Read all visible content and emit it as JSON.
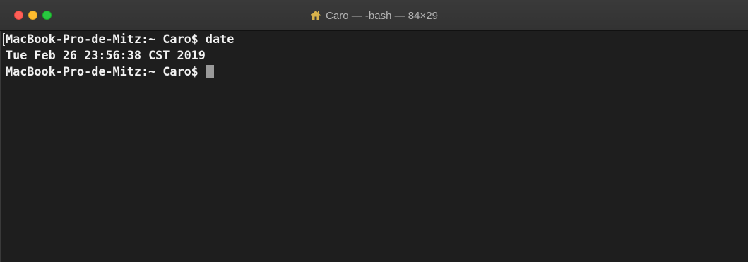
{
  "window": {
    "title": "Caro — -bash — 84×29",
    "title_icon": "home-icon",
    "traffic_lights": {
      "close_color": "#fe5f57",
      "minimize_color": "#febc2e",
      "zoom_color": "#28c840"
    }
  },
  "terminal": {
    "background": "#1e1e1e",
    "foreground": "#f2f2f2",
    "lines": [
      "MacBook-Pro-de-Mitz:~ Caro$ date",
      "Tue Feb 26 23:56:38 CST 2019",
      "MacBook-Pro-de-Mitz:~ Caro$ "
    ]
  }
}
